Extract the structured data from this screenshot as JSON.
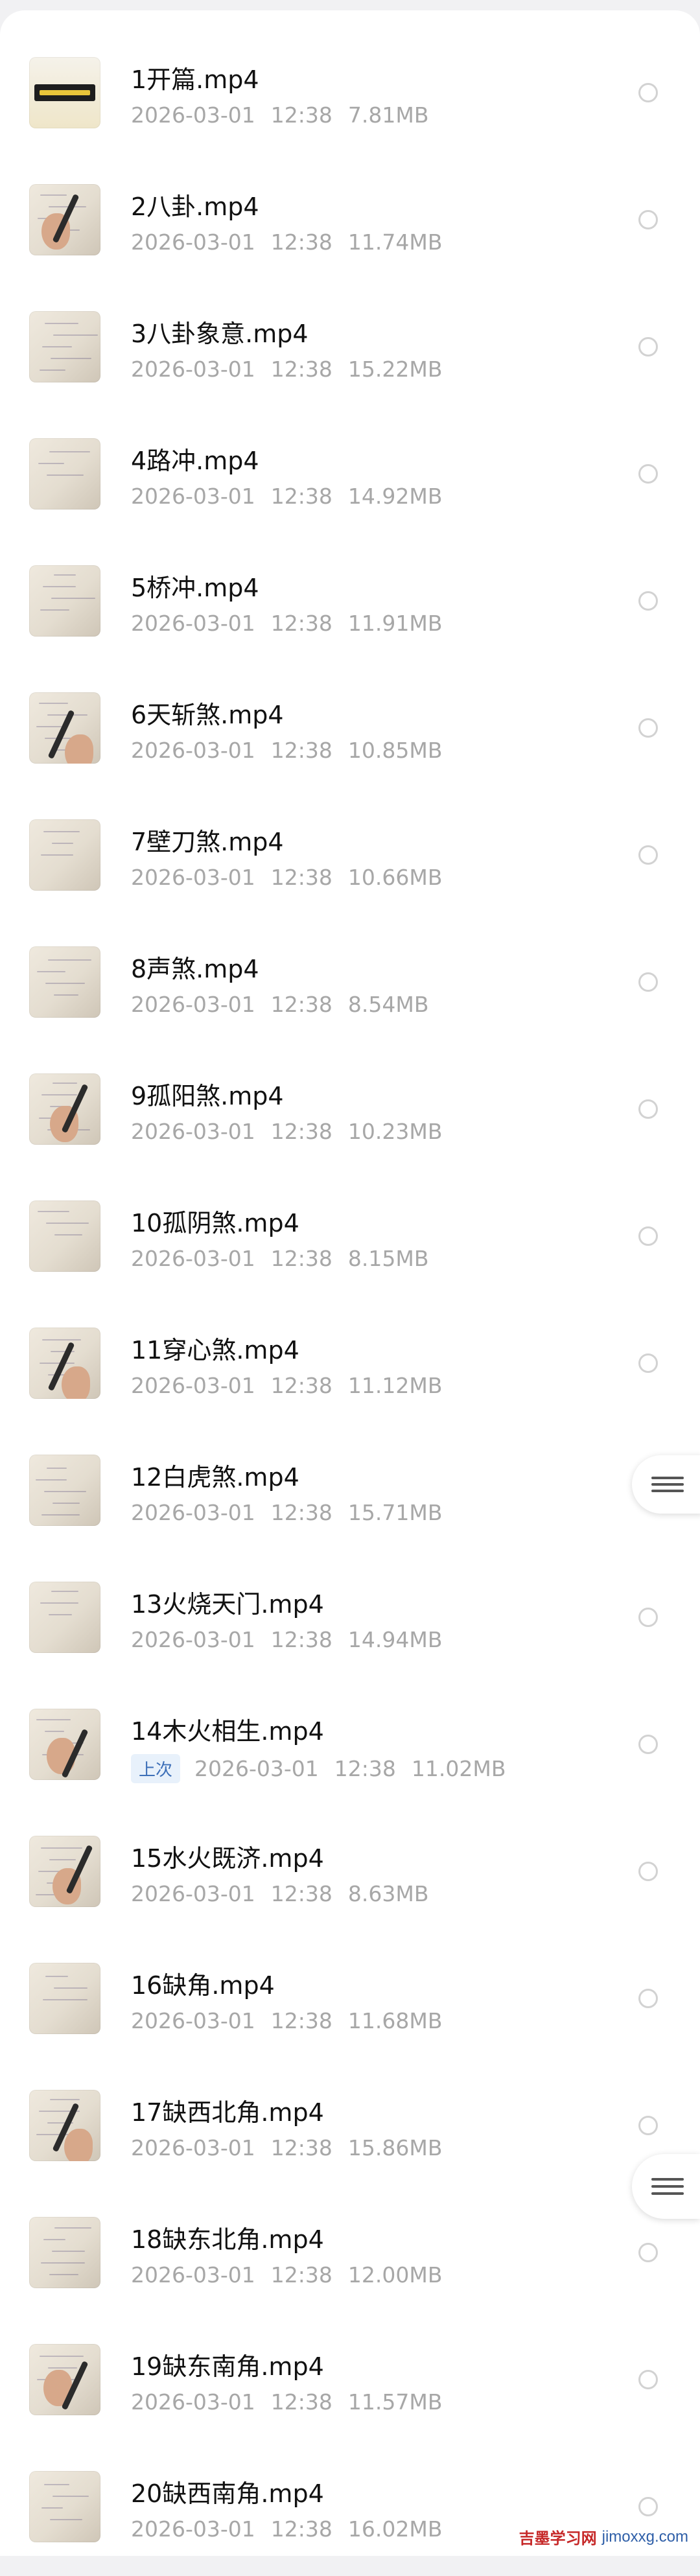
{
  "files": [
    {
      "name": "1开篇.mp4",
      "date": "2026-03-01",
      "time": "12:38",
      "size": "7.81MB",
      "thumb": "cover"
    },
    {
      "name": "2八卦.mp4",
      "date": "2026-03-01",
      "time": "12:38",
      "size": "11.74MB",
      "thumb": "hand"
    },
    {
      "name": "3八卦象意.mp4",
      "date": "2026-03-01",
      "time": "12:38",
      "size": "15.22MB",
      "thumb": "paper"
    },
    {
      "name": "4路冲.mp4",
      "date": "2026-03-01",
      "time": "12:38",
      "size": "14.92MB",
      "thumb": "paper"
    },
    {
      "name": "5桥冲.mp4",
      "date": "2026-03-01",
      "time": "12:38",
      "size": "11.91MB",
      "thumb": "paper"
    },
    {
      "name": "6天斩煞.mp4",
      "date": "2026-03-01",
      "time": "12:38",
      "size": "10.85MB",
      "thumb": "hand"
    },
    {
      "name": "7壁刀煞.mp4",
      "date": "2026-03-01",
      "time": "12:38",
      "size": "10.66MB",
      "thumb": "paper"
    },
    {
      "name": "8声煞.mp4",
      "date": "2026-03-01",
      "time": "12:38",
      "size": "8.54MB",
      "thumb": "paper"
    },
    {
      "name": "9孤阳煞.mp4",
      "date": "2026-03-01",
      "time": "12:38",
      "size": "10.23MB",
      "thumb": "hand"
    },
    {
      "name": "10孤阴煞.mp4",
      "date": "2026-03-01",
      "time": "12:38",
      "size": "8.15MB",
      "thumb": "paper"
    },
    {
      "name": "11穿心煞.mp4",
      "date": "2026-03-01",
      "time": "12:38",
      "size": "11.12MB",
      "thumb": "hand"
    },
    {
      "name": "12白虎煞.mp4",
      "date": "2026-03-01",
      "time": "12:38",
      "size": "15.71MB",
      "thumb": "paper"
    },
    {
      "name": "13火烧天门.mp4",
      "date": "2026-03-01",
      "time": "12:38",
      "size": "14.94MB",
      "thumb": "paper"
    },
    {
      "name": "14木火相生.mp4",
      "date": "2026-03-01",
      "time": "12:38",
      "size": "11.02MB",
      "thumb": "hand",
      "badge": "上次"
    },
    {
      "name": "15水火既济.mp4",
      "date": "2026-03-01",
      "time": "12:38",
      "size": "8.63MB",
      "thumb": "hand"
    },
    {
      "name": "16缺角.mp4",
      "date": "2026-03-01",
      "time": "12:38",
      "size": "11.68MB",
      "thumb": "paper"
    },
    {
      "name": "17缺西北角.mp4",
      "date": "2026-03-01",
      "time": "12:38",
      "size": "15.86MB",
      "thumb": "hand"
    },
    {
      "name": "18缺东北角.mp4",
      "date": "2026-03-01",
      "time": "12:38",
      "size": "12.00MB",
      "thumb": "paper"
    },
    {
      "name": "19缺东南角.mp4",
      "date": "2026-03-01",
      "time": "12:38",
      "size": "11.57MB",
      "thumb": "hand"
    },
    {
      "name": "20缺西南角.mp4",
      "date": "2026-03-01",
      "time": "12:38",
      "size": "16.02MB",
      "thumb": "paper"
    }
  ],
  "floating_buttons": [
    {
      "icon": "menu-icon"
    },
    {
      "icon": "menu-icon"
    }
  ],
  "watermark": {
    "text_cn": "吉墨学习网",
    "url": "jimoxxg.com"
  },
  "colors": {
    "badge_text": "#3d6fb8",
    "badge_bg": "#e8f1fb",
    "watermark_cn": "#c62828"
  }
}
